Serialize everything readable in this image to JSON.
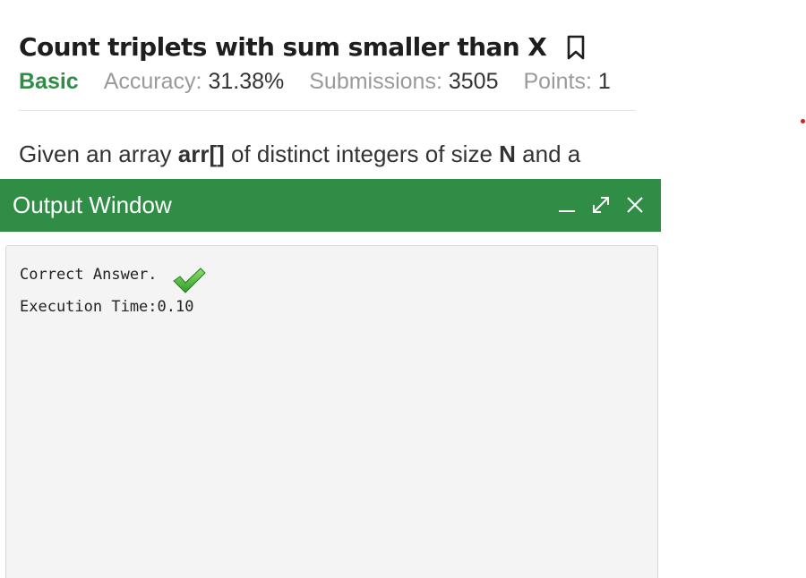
{
  "problem": {
    "title": "Count triplets with sum smaller than X",
    "difficulty": "Basic",
    "accuracy_label": "Accuracy:",
    "accuracy_value": "31.38%",
    "submissions_label": "Submissions:",
    "submissions_value": "3505",
    "points_label": "Points:",
    "points_value": "1",
    "description_parts": [
      "Given an array ",
      "arr[]",
      " of distinct integers of size ",
      "N",
      " and a"
    ]
  },
  "output_window": {
    "title": "Output Window",
    "lines": [
      "Correct Answer.",
      "Execution Time:0.10"
    ]
  },
  "colors": {
    "brand_green": "#2f8d46",
    "header_green": "#308d46"
  },
  "icons": [
    "bookmark-icon",
    "minimize-icon",
    "expand-icon",
    "close-icon",
    "check-icon"
  ]
}
